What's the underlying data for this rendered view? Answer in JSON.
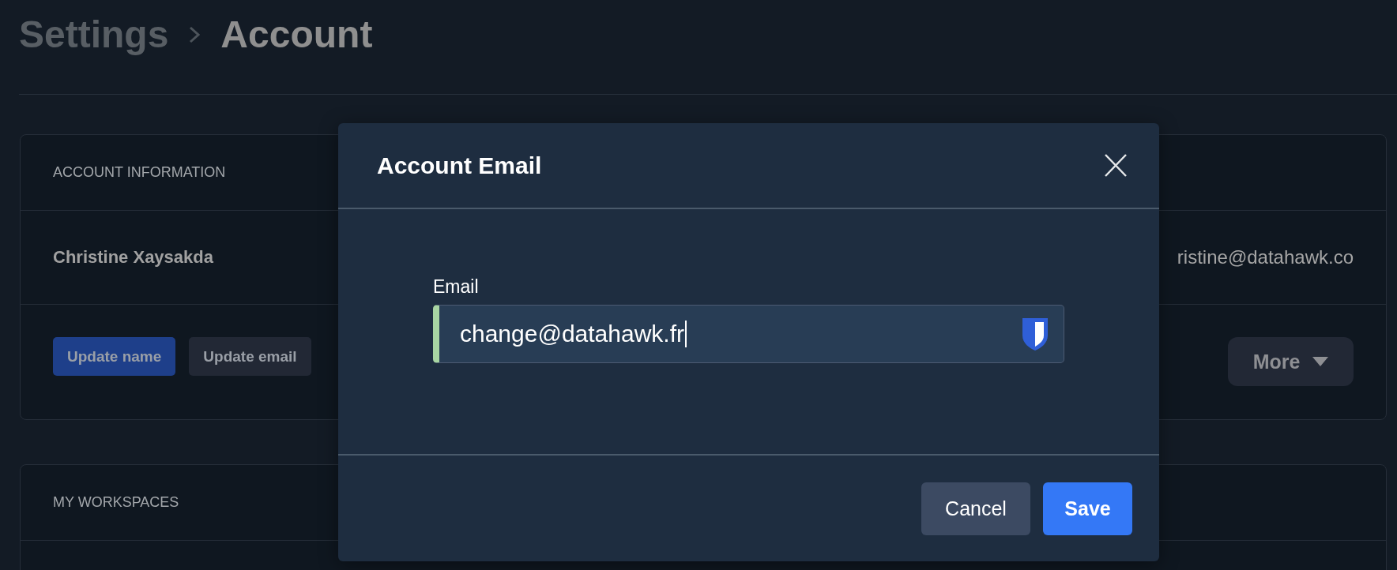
{
  "breadcrumb": {
    "parent": "Settings",
    "current": "Account"
  },
  "account_card": {
    "heading": "ACCOUNT INFORMATION",
    "name": "Christine Xaysakda",
    "email": "ristine@datahawk.co",
    "buttons": [
      {
        "label": "Update name",
        "kind": "primary"
      },
      {
        "label": "Update email",
        "kind": "secondary"
      }
    ],
    "more_button": {
      "label": "More"
    }
  },
  "workspaces_card": {
    "heading": "MY WORKSPACES"
  },
  "dialog": {
    "title": "Account Email",
    "field": {
      "label": "Email",
      "value": "change@datahawk.fr",
      "valid": true,
      "focused": true
    },
    "buttons": [
      {
        "label": "Cancel",
        "kind": "secondary"
      },
      {
        "label": "Save",
        "kind": "primary"
      }
    ]
  }
}
